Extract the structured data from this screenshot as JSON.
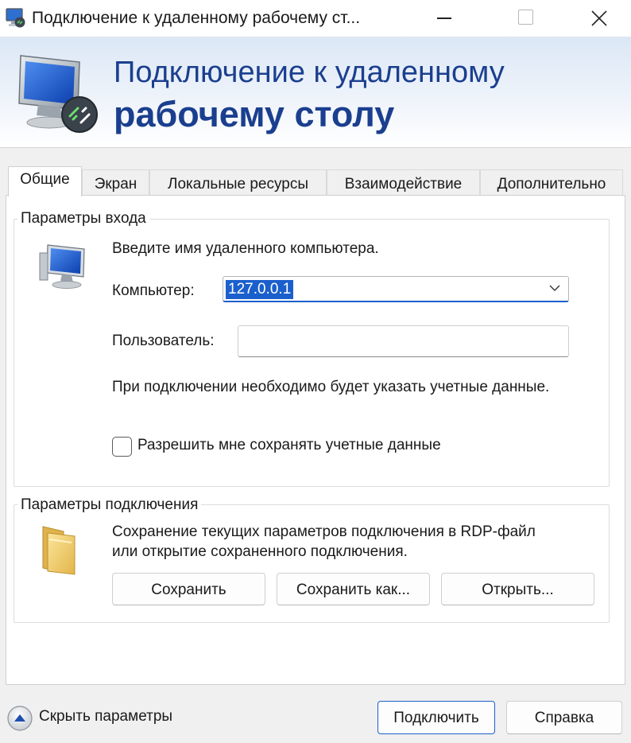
{
  "window": {
    "title": "Подключение к удаленному рабочему ст..."
  },
  "banner": {
    "line1": "Подключение к удаленному",
    "line2": "рабочему столу"
  },
  "tabs": [
    {
      "label": "Общие",
      "active": true
    },
    {
      "label": "Экран",
      "active": false
    },
    {
      "label": "Локальные ресурсы",
      "active": false
    },
    {
      "label": "Взаимодействие",
      "active": false
    },
    {
      "label": "Дополнительно",
      "active": false
    }
  ],
  "logon": {
    "group_title": "Параметры входа",
    "instruction": "Введите имя удаленного компьютера.",
    "computer_label": "Компьютер:",
    "computer_value": "127.0.0.1",
    "user_label": "Пользователь:",
    "user_value": "",
    "note": "При подключении необходимо будет указать учетные данные.",
    "save_credentials_label": "Разрешить мне сохранять учетные данные",
    "save_credentials_checked": false
  },
  "connection": {
    "group_title": "Параметры подключения",
    "description": "Сохранение текущих параметров подключения в RDP-файл или открытие сохраненного подключения.",
    "save_label": "Сохранить",
    "save_as_label": "Сохранить как...",
    "open_label": "Открыть..."
  },
  "footer": {
    "hide_options_label": "Скрыть параметры",
    "connect_label": "Подключить",
    "help_label": "Справка"
  },
  "colors": {
    "banner_text": "#1b3f8f",
    "accent": "#1b5fcc"
  }
}
